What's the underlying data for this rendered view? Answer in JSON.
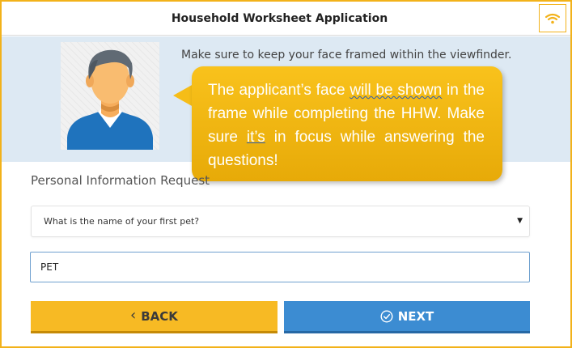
{
  "header": {
    "title": "Household Worksheet Application",
    "wifi_icon": "wifi-icon"
  },
  "camera": {
    "instruction": "Make sure to keep your face framed within the viewfinder.",
    "avatar_icon": "person-avatar-icon"
  },
  "callout": {
    "part1": "The applicant’s face ",
    "part2": "will be shown",
    "part3": " in the frame while completing the HHW. Make sure ",
    "part4": "it’s",
    "part5": " in focus while answering the questions!"
  },
  "form": {
    "section_label": "Personal Information Request",
    "question_selected": "What is the name of your first pet?",
    "answer_value": "PET"
  },
  "buttons": {
    "back_label": "BACK",
    "next_label": "NEXT"
  },
  "colors": {
    "accent_yellow": "#f7ba24",
    "primary_blue": "#3c8cd2",
    "band_blue": "#dde9f3"
  }
}
